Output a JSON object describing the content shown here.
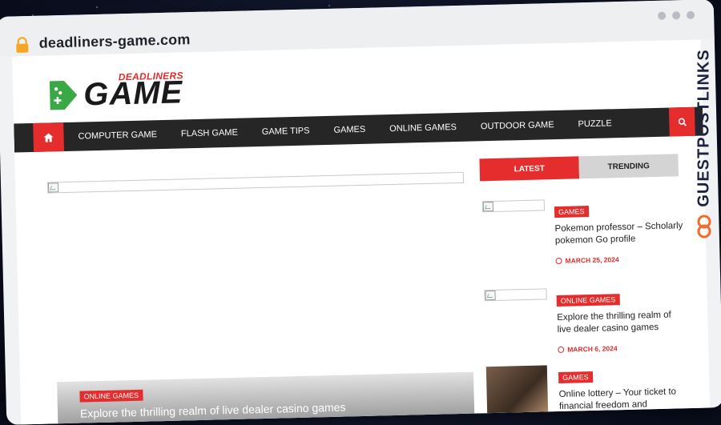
{
  "browser": {
    "url": "deadliners-game.com"
  },
  "logo": {
    "small": "DEADLINERS",
    "big": "GAME"
  },
  "nav": {
    "items": [
      "COMPUTER GAME",
      "FLASH GAME",
      "GAME TIPS",
      "GAMES",
      "ONLINE GAMES",
      "OUTDOOR GAME",
      "PUZZLE"
    ]
  },
  "featured": {
    "badge": "ONLINE GAMES",
    "title": "Explore the thrilling realm of live dealer casino games"
  },
  "sidebar": {
    "tabs": [
      "LATEST",
      "TRENDING"
    ],
    "posts": [
      {
        "badge": "GAMES",
        "title": "Pokemon professor – Scholarly pokemon Go profile",
        "date": "MARCH 25, 2024"
      },
      {
        "badge": "ONLINE GAMES",
        "title": "Explore the thrilling realm of live dealer casino games",
        "date": "MARCH 6, 2024"
      },
      {
        "badge": "GAMES",
        "title": "Online lottery – Your ticket to financial freedom and"
      }
    ]
  },
  "watermark": {
    "text": "GUESTPOSTLINKS"
  },
  "colors": {
    "accent": "#e52d2d",
    "nav": "#262626",
    "brand": "#1c2240",
    "logo_green": "#3aa845"
  }
}
